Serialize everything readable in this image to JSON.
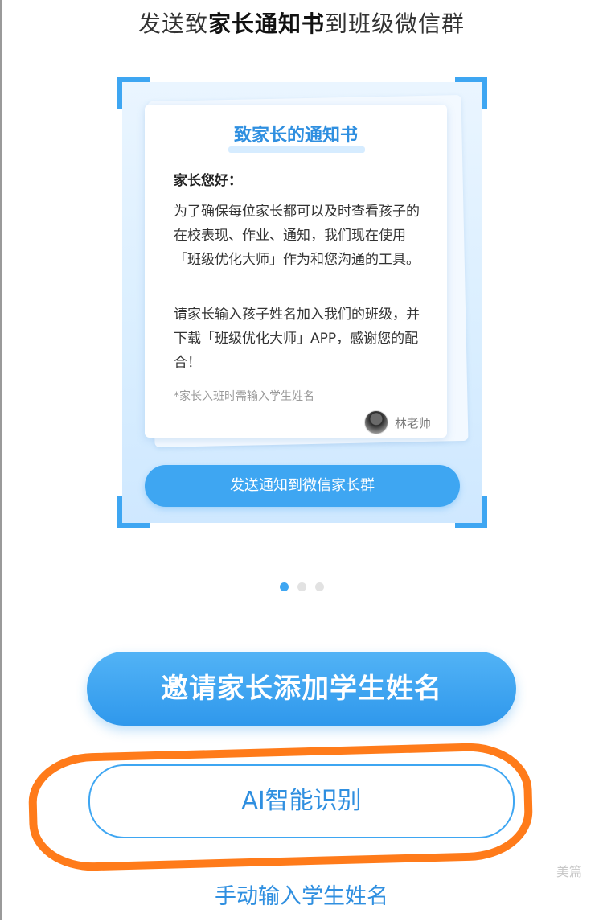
{
  "header": {
    "title_prefix": "发送致",
    "title_bold": "家长通知书",
    "title_suffix": "到班级微信群"
  },
  "letter": {
    "title": "致家长的通知书",
    "greeting": "家长您好：",
    "paragraph1": "为了确保每位家长都可以及时查看孩子的在校表现、作业、通知，我们现在使用「班级优化大师」作为和您沟通的工具。",
    "paragraph2": "请家长输入孩子姓名加入我们的班级，并下载「班级优化大师」APP，感谢您的配合！",
    "note": "*家长入班时需输入学生姓名",
    "signature": "林老师"
  },
  "card_button_label": "发送通知到微信家长群",
  "carousel": {
    "total": 3,
    "active_index": 0
  },
  "invite_button_label": "邀请家长添加学生姓名",
  "ai_button_label": "AI智能识别",
  "manual_link_label": "手动输入学生姓名",
  "watermark": "美篇",
  "colors": {
    "accent": "#3ea6f2",
    "highlight": "#ff7b1a"
  }
}
